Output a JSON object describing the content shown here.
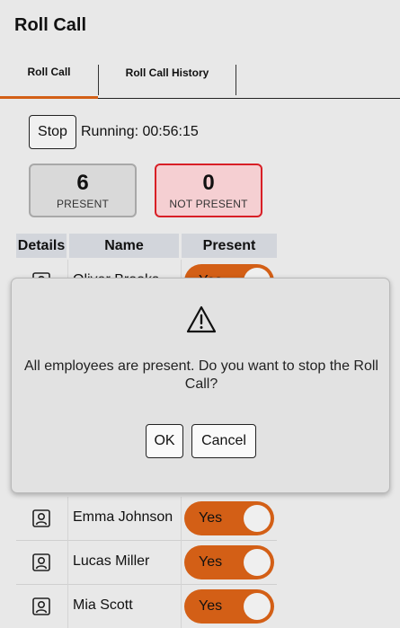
{
  "header": {
    "title": "Roll Call"
  },
  "tabs": [
    {
      "label": "Roll Call",
      "active": true
    },
    {
      "label": "Roll Call History",
      "active": false
    }
  ],
  "controls": {
    "stop_label": "Stop",
    "running_text": "Running: 00:56:15"
  },
  "stats": {
    "present": {
      "count": "6",
      "label": "PRESENT"
    },
    "not_present": {
      "count": "0",
      "label": "NOT PRESENT"
    }
  },
  "table": {
    "headers": [
      "Details",
      "Name",
      "Present"
    ],
    "rows": [
      {
        "name": "Oliver Brooks",
        "present": "Yes"
      },
      {
        "name": "Emma Johnson",
        "present": "Yes"
      },
      {
        "name": "Lucas Miller",
        "present": "Yes"
      },
      {
        "name": "Mia Scott",
        "present": "Yes"
      }
    ]
  },
  "dialog": {
    "message": "All employees are present. Do you want to stop the Roll Call?",
    "ok_label": "OK",
    "cancel_label": "Cancel"
  },
  "colors": {
    "accent": "#d35f16",
    "danger": "#d81f26",
    "background": "#e8e8e8"
  },
  "icons": {
    "details": "person-card-icon",
    "dialog": "warning-icon"
  }
}
